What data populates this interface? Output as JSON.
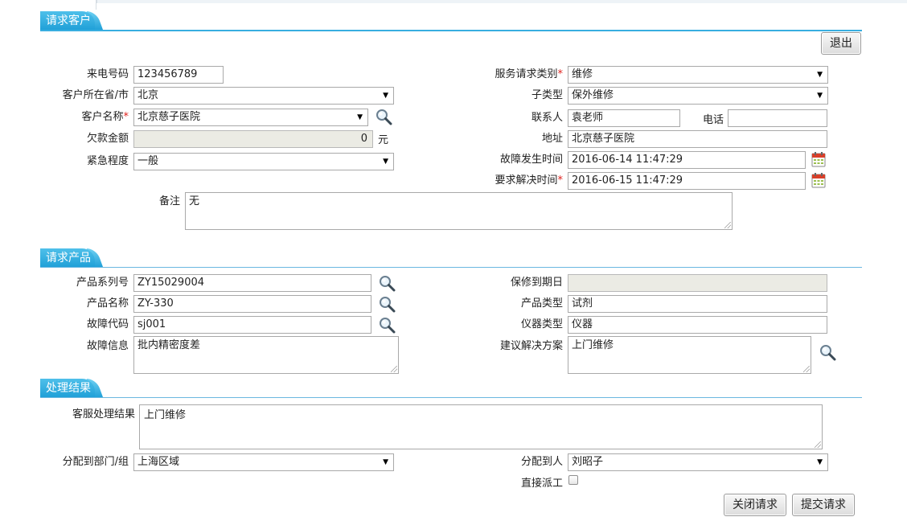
{
  "sections": {
    "customer": "请求客户",
    "product": "请求产品",
    "result": "处理结果"
  },
  "exit_button": "退出",
  "customer": {
    "phone_label": "来电号码",
    "phone_value": "123456789",
    "province_label": "客户所在省/市",
    "province_value": "北京",
    "name_label": "客户名称",
    "name_value": "北京慈子医院",
    "debt_label": "欠款金额",
    "debt_value": "0",
    "debt_unit": "元",
    "urgency_label": "紧急程度",
    "urgency_value": "一般",
    "service_type_label": "服务请求类别",
    "service_type_value": "维修",
    "subtype_label": "子类型",
    "subtype_value": "保外维修",
    "contact_label": "联系人",
    "contact_value": "袁老师",
    "tel_label": "电话",
    "tel_value": "",
    "address_label": "地址",
    "address_value": "北京慈子医院",
    "fault_time_label": "故障发生时间",
    "fault_time_value": "2016-06-14 11:47:29",
    "resolve_time_label": "要求解决时间",
    "resolve_time_value": "2016-06-15 11:47:29",
    "remark_label": "备注",
    "remark_value": "无",
    "required_mark": "*"
  },
  "product": {
    "serial_label": "产品系列号",
    "serial_value": "ZY15029004",
    "name_label": "产品名称",
    "name_value": "ZY-330",
    "fault_code_label": "故障代码",
    "fault_code_value": "sj001",
    "fault_info_label": "故障信息",
    "fault_info_value": "批内精密度差",
    "warranty_label": "保修到期日",
    "warranty_value": "",
    "product_type_label": "产品类型",
    "product_type_value": "试剂",
    "instrument_type_label": "仪器类型",
    "instrument_type_value": "仪器",
    "solution_label": "建议解决方案",
    "solution_value": "上门维修"
  },
  "result": {
    "cs_result_label": "客服处理结果",
    "cs_result_value": "上门维修",
    "dept_label": "分配到部门/组",
    "dept_value": "上海区域",
    "assignee_label": "分配到人",
    "assignee_value": "刘昭子",
    "dispatch_label": "直接派工",
    "close_button": "关闭请求",
    "submit_button": "提交请求"
  },
  "icons": {
    "search": "magnifier-icon",
    "calendar": "calendar-icon",
    "dropdown": "triangle-down"
  },
  "colors": {
    "section_tab": "#1e9fd7",
    "section_line": "#38aee0",
    "required": "#e0211d"
  }
}
